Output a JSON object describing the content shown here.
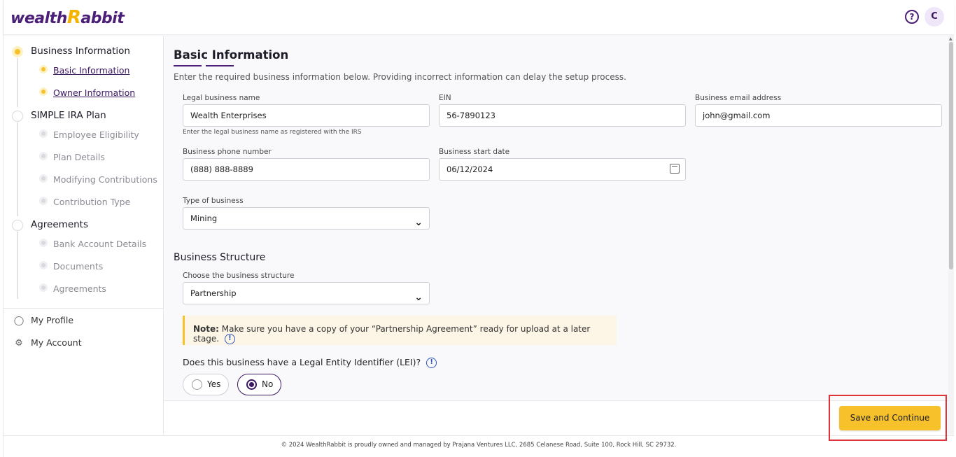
{
  "brand": {
    "logo_pre": "wealth",
    "logo_r": "R",
    "logo_post": "abbit"
  },
  "header": {
    "help_glyph": "?",
    "avatar_initial": "C"
  },
  "sidebar": {
    "sections": [
      {
        "title": "Business Information",
        "items": [
          "Basic Information",
          "Owner Information"
        ]
      },
      {
        "title": "SIMPLE IRA Plan",
        "items": [
          "Employee Eligibility",
          "Plan Details",
          "Modifying Contributions",
          "Contribution Type"
        ]
      },
      {
        "title": "Agreements",
        "items": [
          "Bank Account Details",
          "Documents",
          "Agreements"
        ]
      }
    ],
    "my_profile": "My Profile",
    "my_account": "My Account"
  },
  "main": {
    "title": "Basic Information",
    "intro": "Enter the required business information below. Providing incorrect information can delay the setup process.",
    "fields": {
      "legal_name": {
        "label": "Legal business name",
        "value": "Wealth Enterprises",
        "hint": "Enter the legal business name as registered with the IRS"
      },
      "ein": {
        "label": "EIN",
        "value": "56-7890123"
      },
      "email": {
        "label": "Business email address",
        "value": "john@gmail.com"
      },
      "phone": {
        "label": "Business phone number",
        "value": "(888) 888-8889"
      },
      "start_date": {
        "label": "Business start date",
        "value": "06/12/2024"
      },
      "type": {
        "label": "Type of business",
        "value": "Mining"
      }
    },
    "structure": {
      "section_title": "Business Structure",
      "label": "Choose the business structure",
      "value": "Partnership",
      "note_bold": "Note:",
      "note_text": "Make sure you have a copy of your “Partnership Agreement” ready for upload at a later stage."
    },
    "lei": {
      "question": "Does this business have a Legal Entity Identifier (LEI)?",
      "yes": "Yes",
      "no": "No",
      "selected": "No"
    }
  },
  "actions": {
    "save_continue": "Save and Continue"
  },
  "footer": {
    "text": "© 2024 WealthRabbit is proudly owned and managed by Prajana Ventures LLC, 2685 Celanese Road, Suite 100, Rock Hill, SC 29732."
  },
  "colors": {
    "brand_purple": "#4b1e78",
    "accent_yellow": "#f6c12b",
    "highlight_red": "#e0343a"
  }
}
